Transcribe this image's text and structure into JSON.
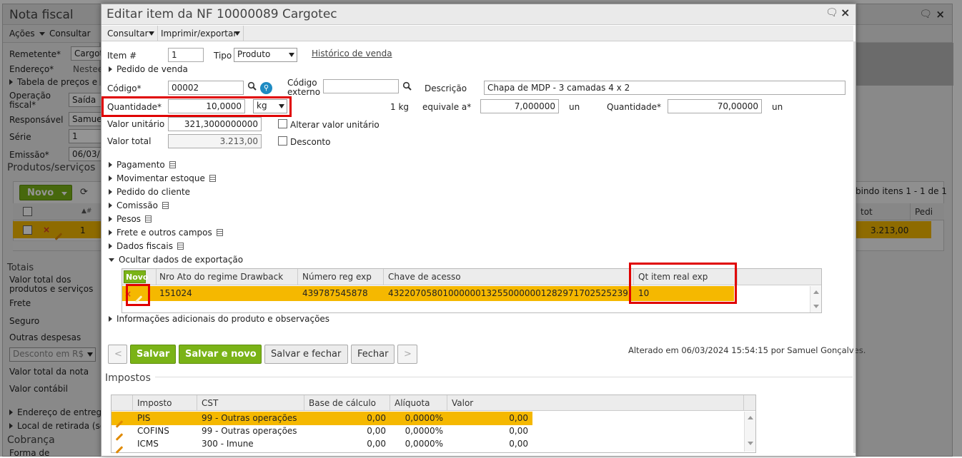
{
  "background": {
    "title": "Nota fiscal",
    "menu": {
      "acoes": "Ações",
      "consultar": "Consultar"
    },
    "fields": [
      {
        "label": "Remetente*",
        "value": "Cargote"
      },
      {
        "label": "Endereço*",
        "value": "Nestee"
      },
      {
        "label": "Tabela de preços e re",
        "value": ""
      },
      {
        "label": "Operação fiscal*",
        "value": "Saída"
      },
      {
        "label": "Responsável",
        "value": "Samue"
      },
      {
        "label": "Série",
        "value": "1"
      },
      {
        "label": "Emissão*",
        "value": "06/03/"
      }
    ],
    "produtos_title": "Produtos/serviços",
    "novo": "Novo",
    "pagination": "bindo itens 1 - 1 de 1",
    "grid_headers": {
      "tot": "tot",
      "pedi": "Pedi"
    },
    "row_num": "1",
    "row_total": "3.213,00",
    "totais_title": "Totais",
    "totais": [
      "Valor total dos produtos e serviços",
      "Frete",
      "Seguro",
      "Outras despesas"
    ],
    "desconto_select": "Desconto em R$",
    "totais2": [
      "Valor total da nota",
      "Valor contábil"
    ],
    "links": [
      "Endereço de entrega",
      "Local de retirada (se"
    ],
    "cobranca_title": "Cobrança",
    "forma": "Forma de"
  },
  "dialog": {
    "title": "Editar item da NF 10000089 Cargotec",
    "menu": {
      "consultar": "Consultar",
      "imprimir": "Imprimir/exportar"
    },
    "item": {
      "label": "Item #",
      "value": "1"
    },
    "tipo": {
      "label": "Tipo",
      "value": "Produto"
    },
    "historico": "Histórico de venda",
    "pedido_venda": "Pedido de venda",
    "codigo": {
      "label": "Código*",
      "value": "00002"
    },
    "codigo_externo": {
      "label1": "Código",
      "label2": "externo",
      "value": ""
    },
    "descricao": {
      "label": "Descrição",
      "value": "Chapa de MDP - 3 camadas 4 x 2"
    },
    "quantidade": {
      "label": "Quantidade*",
      "value": "10,0000",
      "unit": "kg"
    },
    "conv": {
      "text": "1 kg",
      "equivale_label": "equivale a*",
      "equivale_value": "7,000000",
      "un1": "un",
      "qtd_label": "Quantidade*",
      "qtd_value": "70,00000",
      "un2": "un"
    },
    "valor_unitario": {
      "label": "Valor unitário",
      "value": "321,3000000000"
    },
    "alterar": "Alterar valor unitário",
    "valor_total": {
      "label": "Valor total",
      "value": "3.213,00"
    },
    "desconto": "Desconto",
    "sections": [
      "Pagamento",
      "Movimentar estoque",
      "Pedido do cliente",
      "Comissão",
      "Pesos",
      "Frete e outros campos",
      "Dados fiscais"
    ],
    "export_section": "Ocultar dados de exportação",
    "export_grid": {
      "novo": "Novo",
      "headers": [
        "Nro Ato do regime Drawback",
        "Número reg exp",
        "Chave de acesso",
        "Qt item real exp"
      ],
      "row": [
        "151024",
        "439787545878",
        "43220705801000000132550000001282971702525239",
        "10"
      ]
    },
    "info_adicionais": "Informações adicionais do produto e observações",
    "buttons": {
      "prev": "<",
      "salvar": "Salvar",
      "salvar_novo": "Salvar e novo",
      "salvar_fechar": "Salvar e fechar",
      "fechar": "Fechar",
      "next": ">"
    },
    "altered": "Alterado em 06/03/2024 15:54:15 por Samuel Gonçalves.",
    "impostos_title": "Impostos",
    "impostos": {
      "headers": [
        "Imposto",
        "CST",
        "Base de cálculo",
        "Alíquota",
        "Valor"
      ],
      "rows": [
        [
          "PIS",
          "99 - Outras operações",
          "0,00",
          "0,0000%",
          "0,00"
        ],
        [
          "COFINS",
          "99 - Outras operações",
          "0,00",
          "0,0000%",
          "0,00"
        ],
        [
          "ICMS",
          "300 - Imune",
          "0,00",
          "0,0000%",
          "0,00"
        ]
      ]
    }
  },
  "colors": {
    "accent_green": "#7ab317",
    "selected_row": "#f5b800",
    "highlight_red": "#e00000"
  }
}
